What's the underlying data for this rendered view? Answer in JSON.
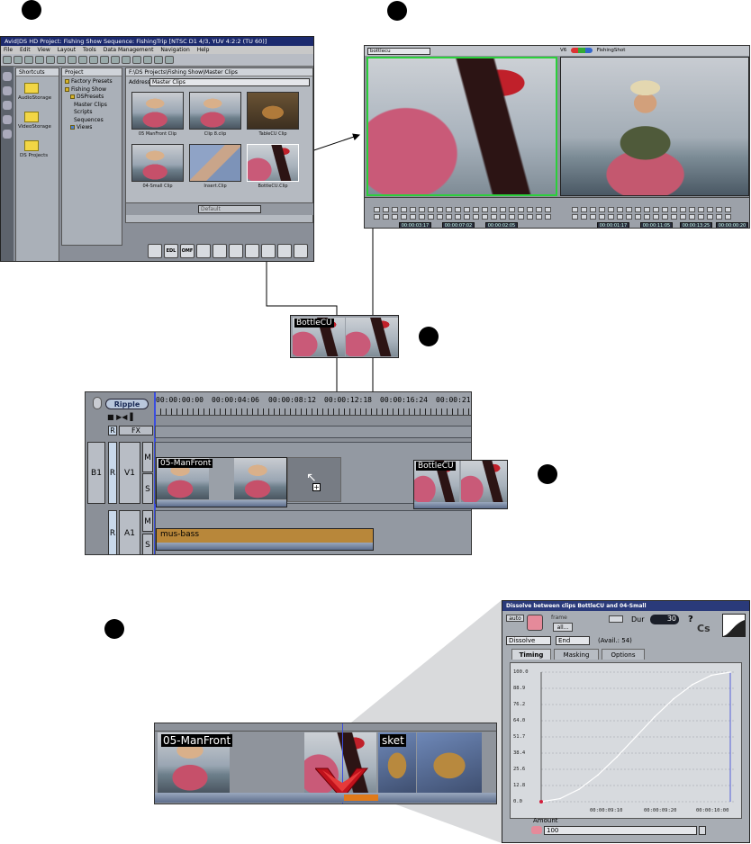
{
  "markers": [
    "step-1",
    "step-2",
    "step-3",
    "step-4",
    "step-5"
  ],
  "app": {
    "title": "Avid|DS HD Project: Fishing Show    Sequence: FishingTrip    [NTSC D1 4/3, YUV 4:2:2 (TU 60)]",
    "menu": [
      "File",
      "Edit",
      "View",
      "Layout",
      "Tools",
      "Data Management",
      "Navigation",
      "Help"
    ]
  },
  "shortcuts": {
    "title": "Shortcuts",
    "items": [
      "AudioStorage",
      "VideoStorage",
      "DS Projects"
    ]
  },
  "project": {
    "title": "Project",
    "tree": [
      "Factory Presets",
      "Fishing Show",
      "DSPresets",
      "Master Clips",
      "Scripts",
      "Sequences",
      "Views"
    ]
  },
  "browser": {
    "title": "F:\\DS Projects\\Fishing Show\\Master Clips",
    "address_label": "Address",
    "address_value": "Master Clips",
    "clips": [
      "05 ManFront Clip",
      "Clip 8.clip",
      "TableCU Clip",
      "04-Small Clip",
      "Insert.Clip",
      "BottleCU.Clip"
    ],
    "view_select": "Default"
  },
  "dock": [
    "EDL",
    "OMF"
  ],
  "viewer": {
    "left_source": "bottlecu",
    "right_source": "FishingShot",
    "v_label": "V6",
    "timecodes": [
      "00:00:03:17",
      "00:00:07:02",
      "00:00:02:05",
      "00:00:01:17",
      "00:00:11:05",
      "00:00:13:25",
      "00:00:00:20"
    ]
  },
  "drag": {
    "label": "BottleCU"
  },
  "timeline": {
    "mode": "Ripple",
    "timecodes": [
      "00:00:00:00",
      "00:00:04:06",
      "00:00:08:12",
      "00:00:12:18",
      "00:00:16:24",
      "00:00:21"
    ],
    "track_header": {
      "r": "R",
      "fx": "FX"
    },
    "video_track": {
      "b": "B1",
      "r": "R",
      "name": "V1",
      "m": "M",
      "s": "S"
    },
    "audio_track": {
      "r": "R",
      "name": "A1",
      "m": "M",
      "s": "S"
    },
    "video_clip": "05-ManFront",
    "audio_clip": "mus-bass",
    "ghost_clip": "BottleCU",
    "drop_indicator": "+"
  },
  "strip": {
    "clip_a": "05-ManFront",
    "clip_b_tail": "sket"
  },
  "dissolve": {
    "title": "Dissolve between clips BottleCU and 04-Small",
    "auto_label": "auto",
    "frame_label": "frame",
    "all_label": "all...",
    "dur_label": "Dur",
    "dur_value": "30",
    "type": "Dissolve",
    "position": "End",
    "avail": "(Avail.: 54)",
    "tabs": [
      "Timing",
      "Masking",
      "Options"
    ],
    "amount_label": "Amount",
    "amount_value": "100",
    "help_icon": "?"
  },
  "chart_data": {
    "type": "line",
    "y_ticks": [
      "100.0",
      "88.9",
      "76.2",
      "64.0",
      "51.7",
      "38.4",
      "25.6",
      "12.8",
      "0.0"
    ],
    "x_ticks": [
      "00:00:09:10",
      "00:00:09:20",
      "00:00:10:00"
    ],
    "ylim": [
      0,
      100
    ],
    "series": [
      {
        "x": [
          0,
          0.1,
          0.2,
          0.3,
          0.4,
          0.5,
          0.6,
          0.7,
          0.8,
          0.9,
          1.0
        ],
        "values": [
          0,
          2.4,
          9.6,
          20.6,
          34.5,
          50,
          65.5,
          79.4,
          90.4,
          97.6,
          100
        ]
      }
    ]
  },
  "colors": {
    "accent_blue": "#2a3a7a",
    "clip_audio": "#b8873a",
    "selection_green": "#2bd03b",
    "transition_red": "#c0121c"
  }
}
